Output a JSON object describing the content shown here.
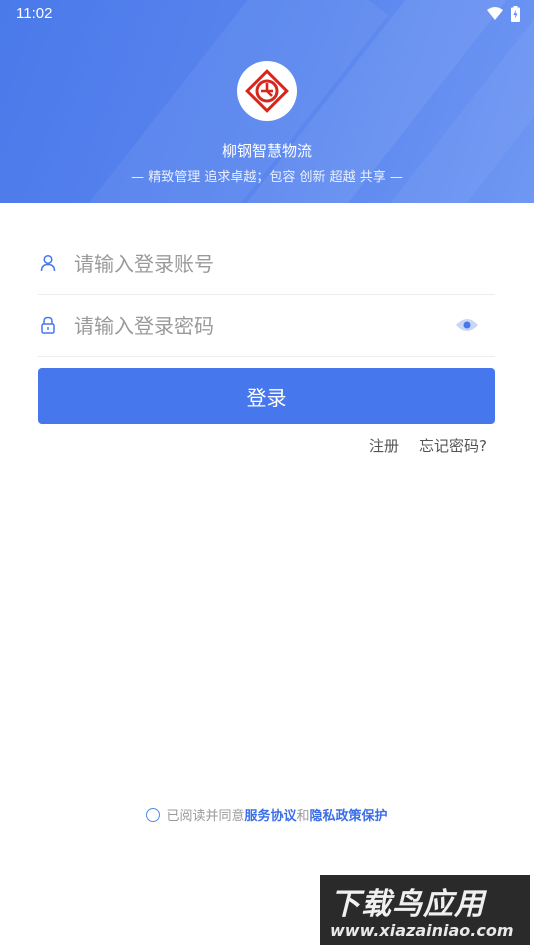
{
  "status_bar": {
    "time": "11:02"
  },
  "header": {
    "app_name": "柳钢智慧物流",
    "slogan": "— 精致管理 追求卓越；包容 创新 超越 共享 —"
  },
  "form": {
    "account_placeholder": "请输入登录账号",
    "password_placeholder": "请输入登录密码",
    "login_label": "登录",
    "register_label": "注册",
    "forgot_label": "忘记密码?"
  },
  "agreement": {
    "prefix": "已阅读并同意",
    "service_label": "服务协议",
    "and": "和",
    "privacy_label": "隐私政策保护"
  },
  "watermark": {
    "title": "下载鸟应用",
    "url": "www.xiazainiao.com"
  },
  "colors": {
    "primary": "#4677ec",
    "link": "#3a6ee8",
    "logo_red": "#d9261c"
  }
}
